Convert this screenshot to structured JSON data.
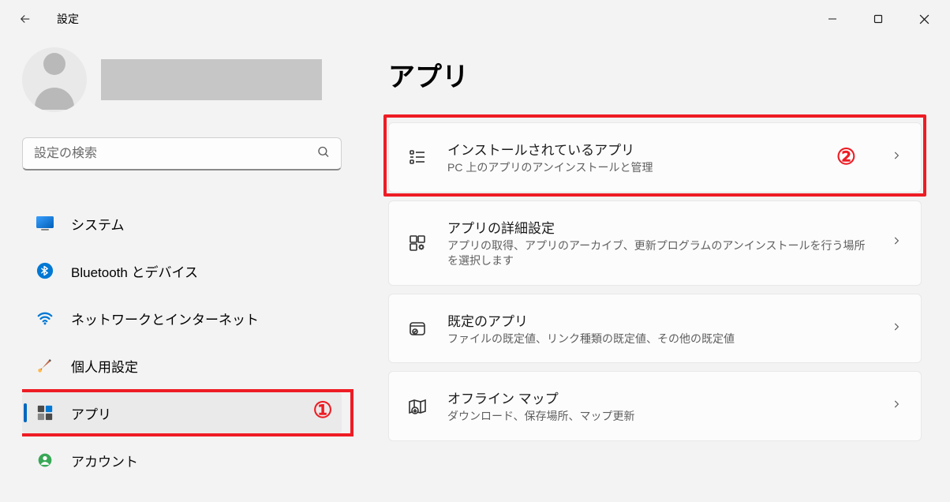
{
  "window": {
    "title": "設定"
  },
  "search": {
    "placeholder": "設定の検索"
  },
  "sidebar": {
    "items": [
      {
        "label": "システム"
      },
      {
        "label": "Bluetooth とデバイス"
      },
      {
        "label": "ネットワークとインターネット"
      },
      {
        "label": "個人用設定"
      },
      {
        "label": "アプリ"
      },
      {
        "label": "アカウント"
      }
    ]
  },
  "page": {
    "title": "アプリ"
  },
  "cards": [
    {
      "title": "インストールされているアプリ",
      "sub": "PC 上のアプリのアンインストールと管理"
    },
    {
      "title": "アプリの詳細設定",
      "sub": "アプリの取得、アプリのアーカイブ、更新プログラムのアンインストールを行う場所を選択します"
    },
    {
      "title": "既定のアプリ",
      "sub": "ファイルの既定値、リンク種類の既定値、その他の既定値"
    },
    {
      "title": "オフライン マップ",
      "sub": "ダウンロード、保存場所、マップ更新"
    }
  ],
  "annotations": {
    "step1": "①",
    "step2": "②"
  }
}
